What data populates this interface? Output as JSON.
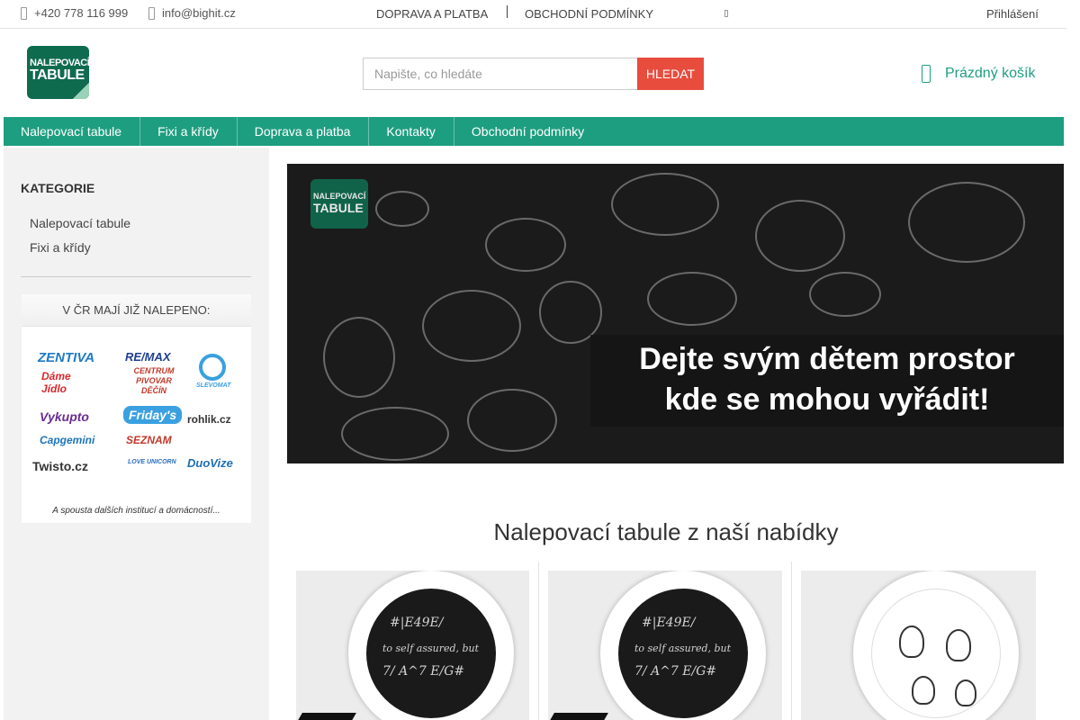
{
  "topbar": {
    "phone": "+420 778 116 999",
    "email": "info@bighit.cz",
    "links": [
      "DOPRAVA A PLATBA",
      "OBCHODNÍ PODMÍNKY"
    ],
    "login": "Přihlášení"
  },
  "header": {
    "logo_line1": "NALEPOVACÍ",
    "logo_line2": "TABULE",
    "search_placeholder": "Napište, co hledáte",
    "search_button": "HLEDAT",
    "cart_label": "Prázdný košík"
  },
  "nav": {
    "items": [
      "Nalepovací tabule",
      "Fixi a křídy",
      "Doprava a platba",
      "Kontakty",
      "Obchodní podmínky"
    ]
  },
  "sidebar": {
    "category_title": "KATEGORIE",
    "categories": [
      "Nalepovací tabule",
      "Fixi a křídy"
    ],
    "brands_heading": "V ČR MAJÍ JIŽ NALEPENO:",
    "brands": [
      "ZENTIVA",
      "RE/MAX",
      "Dáme Jídlo",
      "CENTRUM PIVOVAR DĚČÍN",
      "SLEVOMAT",
      "Vykupto",
      "Friday's",
      "rohlik.cz",
      "Capgemini",
      "SEZNAM",
      "Twisto.cz",
      "LOVE UNICORN",
      "DuoVize"
    ],
    "brands_footer": "A spousta dalších institucí a domácností..."
  },
  "banner": {
    "logo_line1": "NALEPOVACÍ",
    "logo_line2": "TABULE",
    "caption_line1": "Dejte svým dětem prostor",
    "caption_line2": "kde se mohou vyřádit!"
  },
  "main": {
    "section_title": "Nalepovací tabule z naší nabídky"
  },
  "colors": {
    "brand_green": "#1e9e80",
    "search_red": "#e84c3d",
    "sidebar_bg": "#f2f2f2"
  }
}
